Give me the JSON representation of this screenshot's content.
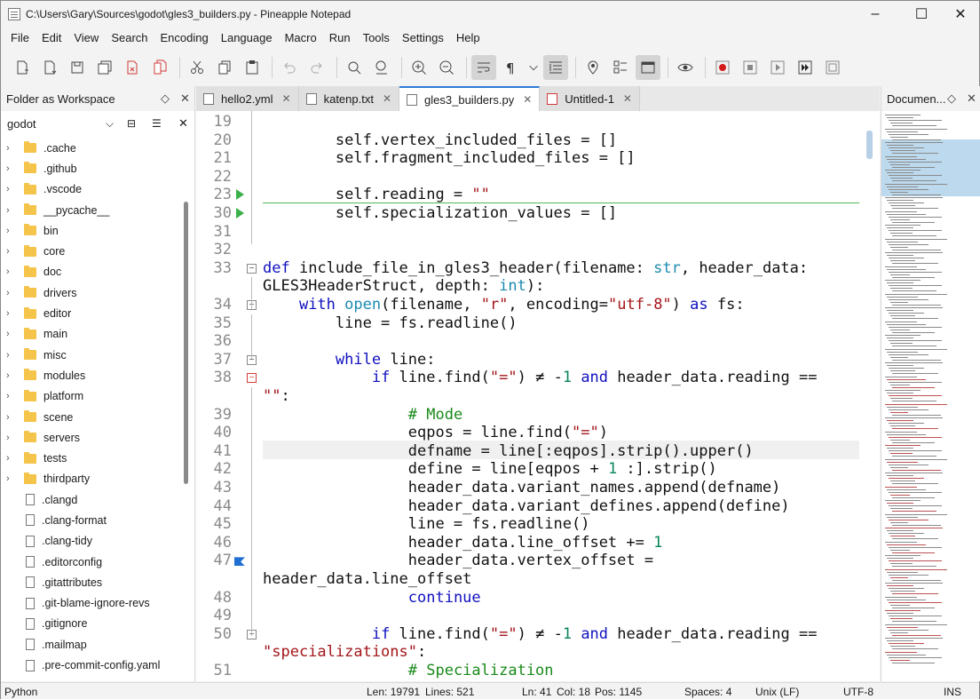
{
  "window": {
    "title": "C:\\Users\\Gary\\Sources\\godot\\gles3_builders.py - Pineapple Notepad",
    "minimize": "–",
    "maximize": "☐",
    "close": "✕"
  },
  "menu": [
    "File",
    "Edit",
    "View",
    "Search",
    "Encoding",
    "Language",
    "Macro",
    "Run",
    "Tools",
    "Settings",
    "Help"
  ],
  "left_panel": {
    "title": "Folder as Workspace",
    "folder": "godot",
    "items": [
      {
        "name": ".cache",
        "type": "folder"
      },
      {
        "name": ".github",
        "type": "folder"
      },
      {
        "name": ".vscode",
        "type": "folder"
      },
      {
        "name": "__pycache__",
        "type": "folder"
      },
      {
        "name": "bin",
        "type": "folder"
      },
      {
        "name": "core",
        "type": "folder"
      },
      {
        "name": "doc",
        "type": "folder"
      },
      {
        "name": "drivers",
        "type": "folder"
      },
      {
        "name": "editor",
        "type": "folder"
      },
      {
        "name": "main",
        "type": "folder"
      },
      {
        "name": "misc",
        "type": "folder"
      },
      {
        "name": "modules",
        "type": "folder"
      },
      {
        "name": "platform",
        "type": "folder"
      },
      {
        "name": "scene",
        "type": "folder"
      },
      {
        "name": "servers",
        "type": "folder"
      },
      {
        "name": "tests",
        "type": "folder"
      },
      {
        "name": "thirdparty",
        "type": "folder"
      },
      {
        "name": ".clangd",
        "type": "file"
      },
      {
        "name": ".clang-format",
        "type": "file"
      },
      {
        "name": ".clang-tidy",
        "type": "file"
      },
      {
        "name": ".editorconfig",
        "type": "file"
      },
      {
        "name": ".gitattributes",
        "type": "file"
      },
      {
        "name": ".git-blame-ignore-revs",
        "type": "file"
      },
      {
        "name": ".gitignore",
        "type": "file"
      },
      {
        "name": ".mailmap",
        "type": "file"
      },
      {
        "name": ".pre-commit-config.yaml",
        "type": "file"
      }
    ]
  },
  "tabs": [
    {
      "label": "hello2.yml",
      "active": false
    },
    {
      "label": "katenp.txt",
      "active": false
    },
    {
      "label": "gles3_builders.py",
      "active": true
    },
    {
      "label": "Untitled-1",
      "active": false
    }
  ],
  "right_panel": {
    "title": "Documen..."
  },
  "lines": [
    {
      "n": "19",
      "html": ""
    },
    {
      "n": "20",
      "html": "        self.vertex_included_files = []"
    },
    {
      "n": "21",
      "html": "        self.fragment_included_files = []"
    },
    {
      "n": "22",
      "html": ""
    },
    {
      "n": "23",
      "html": "        self.reading = <s>\"\"</s>"
    },
    {
      "n": "30",
      "html": "        self.specialization_values = []"
    },
    {
      "n": "31",
      "html": ""
    },
    {
      "n": "32",
      "html": ""
    },
    {
      "n": "33",
      "html": "<k>def</k> include_file_in_gles3_header(filename: <t>str</t>, header_data:"
    },
    {
      "n": "",
      "html": "GLES3HeaderStruct, depth: <t>int</t>):"
    },
    {
      "n": "34",
      "html": "    <k>with</k> <t>open</t>(filename, <s>\"r\"</s>, encoding=<s>\"utf-8\"</s>) <k>as</k> fs:"
    },
    {
      "n": "35",
      "html": "        line = fs.readline()"
    },
    {
      "n": "36",
      "html": ""
    },
    {
      "n": "37",
      "html": "        <k>while</k> line:"
    },
    {
      "n": "38",
      "html": "            <k>if</k> line.find(<s>\"=\"</s>) ≠ -<n>1</n> <k>and</k> header_data.reading =="
    },
    {
      "n": "",
      "html": "<s>\"\"</s>:"
    },
    {
      "n": "39",
      "html": "                <c># Mode</c>"
    },
    {
      "n": "40",
      "html": "                eqpos = line.find(<s>\"=\"</s>)"
    },
    {
      "n": "41",
      "html": "                defname = line[:eqpos].strip().upper()"
    },
    {
      "n": "42",
      "html": "                define = line[eqpos + <n>1</n> :].strip()"
    },
    {
      "n": "43",
      "html": "                header_data.variant_names.append(defname)"
    },
    {
      "n": "44",
      "html": "                header_data.variant_defines.append(define)"
    },
    {
      "n": "45",
      "html": "                line = fs.readline()"
    },
    {
      "n": "46",
      "html": "                header_data.line_offset += <n>1</n>"
    },
    {
      "n": "47",
      "html": "                header_data.vertex_offset ="
    },
    {
      "n": "",
      "html": "header_data.line_offset"
    },
    {
      "n": "48",
      "html": "                <k>continue</k>"
    },
    {
      "n": "49",
      "html": ""
    },
    {
      "n": "50",
      "html": "            <k>if</k> line.find(<s>\"=\"</s>) ≠ -<n>1</n> <k>and</k> header_data.reading =="
    },
    {
      "n": "",
      "html": "<s>\"specializations\"</s>:"
    },
    {
      "n": "51",
      "html": "                <c># Specialization</c>"
    }
  ],
  "status": {
    "language": "Python",
    "len": "Len: 19791",
    "lines": "Lines: 521",
    "ln": "Ln: 41",
    "col": "Col: 18",
    "pos": "Pos: 1145",
    "spaces": "Spaces: 4",
    "eol": "Unix (LF)",
    "encoding": "UTF-8",
    "mode": "INS"
  },
  "colors": {
    "keyword": "#1010c0",
    "string": "#a3151a",
    "comment": "#1a8a1a",
    "builtin": "#1b8bb0",
    "accent": "#2f7bd8"
  }
}
